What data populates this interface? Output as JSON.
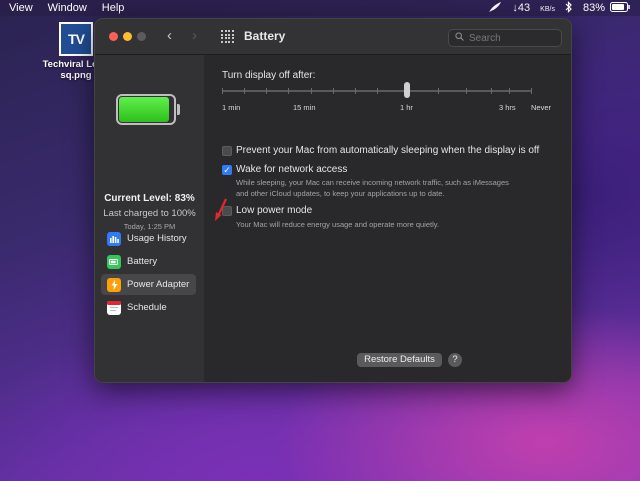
{
  "menubar": {
    "items": [
      "View",
      "Window",
      "Help"
    ],
    "network": "↓43",
    "network_unit": "KB/s",
    "battery_percent": "83%"
  },
  "desktop": {
    "file_label": "Techviral Logo sq.png",
    "file_icon_text": "TV"
  },
  "window": {
    "title": "Battery",
    "search_placeholder": "Search"
  },
  "sidebar": {
    "current_level": "Current Level: 83%",
    "last_charged": "Last charged to 100%",
    "charged_time": "Today, 1:25 PM",
    "battery_level_fraction": 0.83,
    "items": [
      {
        "label": "Usage History",
        "icon": "usage-history-icon",
        "color": "#2f7cf6"
      },
      {
        "label": "Battery",
        "icon": "battery-icon",
        "color": "#34c759"
      },
      {
        "label": "Power Adapter",
        "icon": "power-adapter-icon",
        "color": "#ff9f0a"
      },
      {
        "label": "Schedule",
        "icon": "calendar-icon",
        "color": "#ffffff"
      }
    ],
    "active_index": 2
  },
  "main": {
    "display_off_label": "Turn display off after:",
    "slider_ticks": [
      "1 min",
      "15 min",
      "1 hr",
      "3 hrs",
      "Never"
    ],
    "slider_value": "1 hr",
    "options": [
      {
        "label": "Prevent your Mac from automatically sleeping when the display is off",
        "checked": false
      },
      {
        "label": "Wake for network access",
        "checked": true,
        "description": [
          "While sleeping, your Mac can receive incoming network traffic, such as iMessages",
          "and other iCloud updates, to keep your applications up to date."
        ]
      },
      {
        "label": "Low power mode",
        "checked": false,
        "description": [
          "Your Mac will reduce energy usage and operate more quietly."
        ]
      }
    ],
    "restore_defaults": "Restore Defaults",
    "help": "?"
  },
  "colors": {
    "accent": "#2f7cf6",
    "annotation_arrow": "#e0282e"
  }
}
